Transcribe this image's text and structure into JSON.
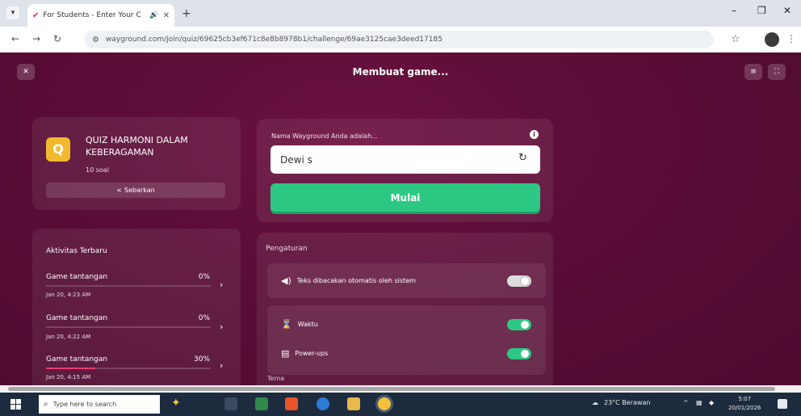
{
  "browser": {
    "tab_title": "For Students - Enter Your C",
    "new_tab_symbol": "+",
    "url": "wayground.com/join/quiz/69625cb3ef671c8e8b8978b1/challenge/69ae3125cae3deed17185",
    "window_controls": [
      "–",
      "❐",
      "✕"
    ]
  },
  "app": {
    "page_title": "Membuat game..."
  },
  "quiz": {
    "title": "QUIZ HARMONI DALAM KEBERAGAMAN",
    "count": "10 soal",
    "logo_letter": "Q",
    "share_label": "Sebarkan"
  },
  "activity": {
    "title": "Aktivitas Terbaru",
    "items": [
      {
        "name": "Game tantangan",
        "percent": "0%",
        "progress": 0,
        "date": "Jan 20, 4:23 AM"
      },
      {
        "name": "Game tantangan",
        "percent": "0%",
        "progress": 0,
        "date": "Jan 20, 4:22 AM"
      },
      {
        "name": "Game tantangan",
        "percent": "30%",
        "progress": 30,
        "date": "Jan 20, 4:15 AM"
      }
    ]
  },
  "join": {
    "name_label": "Nama Wayground Anda adalah...",
    "name_value": "Dewi s",
    "start_label": "Mulai"
  },
  "settings": {
    "title": "Pengaturan",
    "items": [
      {
        "label": "Teks dibacakan otomatis oleh sistem",
        "icon": "speaker-icon",
        "enabled": false
      },
      {
        "label": "Waktu",
        "icon": "timer-icon",
        "enabled": true
      },
      {
        "label": "Power-ups",
        "icon": "power-ups-icon",
        "enabled": true
      }
    ],
    "theme_label": "Tema"
  },
  "taskbar": {
    "search_placeholder": "Type here to search",
    "weather": "23°C Berawan",
    "time": "5:07",
    "date": "20/01/2026"
  },
  "colors": {
    "background": "#5b0d37",
    "accent_green": "#2cc883",
    "logo_yellow": "#f2b92f",
    "progress_red": "#ea3b6f"
  }
}
